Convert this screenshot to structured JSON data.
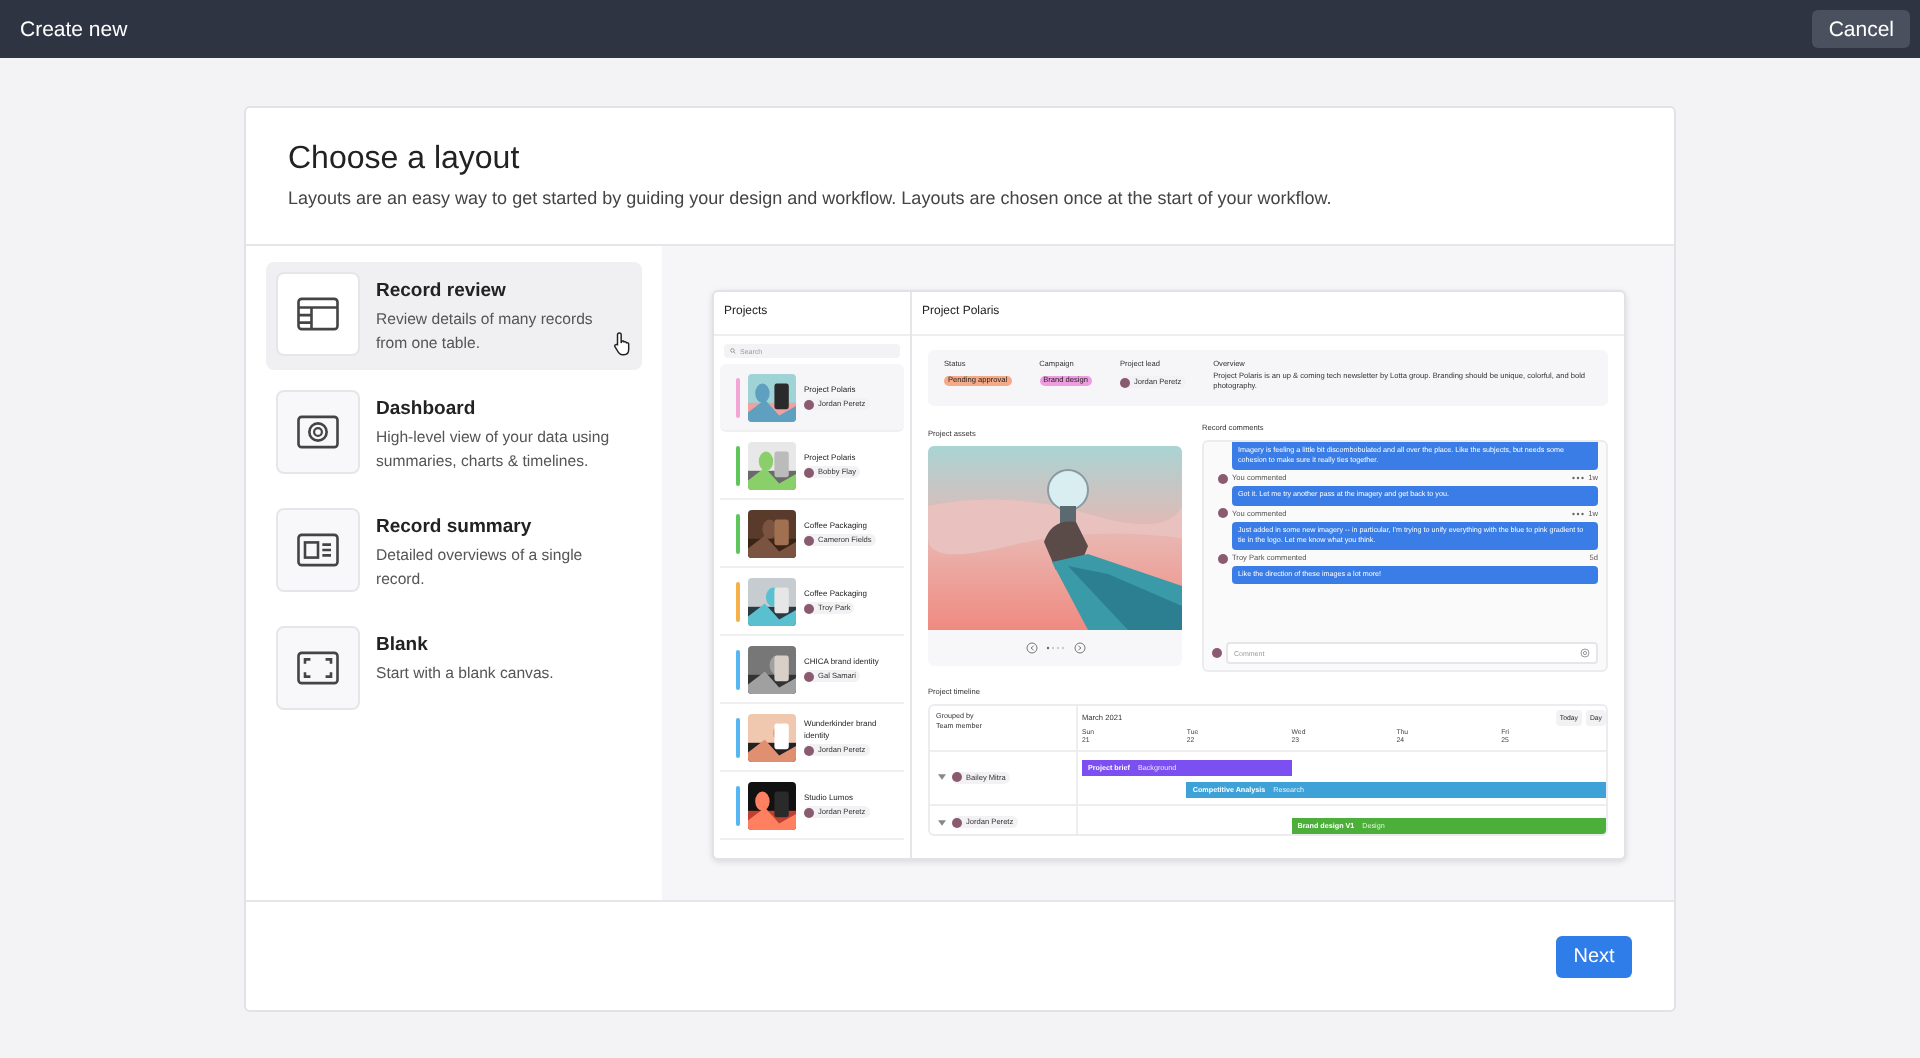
{
  "top_bar": {
    "title": "Create new",
    "cancel": "Cancel"
  },
  "dialog": {
    "title": "Choose a layout",
    "subtitle": "Layouts are an easy way to get started by guiding your design and workflow. Layouts are chosen once at the start of your workflow.",
    "next": "Next"
  },
  "layouts": [
    {
      "name": "Record review",
      "description": "Review details of many records from one table.",
      "selected": true
    },
    {
      "name": "Dashboard",
      "description": "High-level view of your data using summaries, charts & timelines.",
      "selected": false
    },
    {
      "name": "Record summary",
      "description": "Detailed overviews of a single record.",
      "selected": false
    },
    {
      "name": "Blank",
      "description": "Start with a blank canvas.",
      "selected": false
    }
  ],
  "preview": {
    "projects_title": "Projects",
    "search_placeholder": "Search",
    "projects": [
      {
        "name": "Project Polaris",
        "owner": "Jordan Peretz",
        "color": "#f3a6d6",
        "selected": true
      },
      {
        "name": "Project Polaris",
        "owner": "Bobby Flay",
        "color": "#5ec65b",
        "selected": false
      },
      {
        "name": "Coffee Packaging",
        "owner": "Cameron Fields",
        "color": "#5ec65b",
        "selected": false
      },
      {
        "name": "Coffee Packaging",
        "owner": "Troy Park",
        "color": "#f5b04a",
        "selected": false
      },
      {
        "name": "CHICA brand identity",
        "owner": "Gal Samari",
        "color": "#56b6f2",
        "selected": false
      },
      {
        "name": "Wunderkinder brand identity",
        "owner": "Jordan Peretz",
        "color": "#56b6f2",
        "selected": false
      },
      {
        "name": "Studio Lumos",
        "owner": "Jordan Peretz",
        "color": "#56b6f2",
        "selected": false
      }
    ],
    "record_title": "Project Polaris",
    "fields": [
      {
        "label": "Status",
        "value": "Pending approval",
        "color": "#f6a987"
      },
      {
        "label": "Campaign",
        "value": "Brand design",
        "color": "#ee9be0"
      }
    ],
    "lead": {
      "label": "Project lead",
      "value": "Jordan Peretz"
    },
    "overview": {
      "label": "Overview",
      "text": "Project Polaris is an up & coming tech newsletter by Lotta group. Branding should be unique, colorful, and bold photography."
    },
    "assets_title": "Project assets",
    "comments_title": "Record comments",
    "comments": [
      {
        "text": "Imagery is feeling a little bit discombobulated and all over the place. Like the subjects, but needs some cohesion to make sure it really ties together."
      },
      {
        "author": "You commented",
        "time": "1w",
        "menu": true,
        "text": "Got it. Let me try another pass at the imagery and get back to you."
      },
      {
        "author": "You commented",
        "time": "1w",
        "menu": true,
        "text": "Just added in some new imagery -- in particular, I'm trying to unify everything with the blue to pink gradient to tie in the logo. Let me know what you think."
      },
      {
        "author": "Troy Park commented",
        "time": "5d",
        "menu": false,
        "text": "Like the direction of these images a lot more!"
      }
    ],
    "comment_placeholder": "Comment",
    "timeline": {
      "title": "Project timeline",
      "group_label": "Grouped by",
      "group_value": "Team member",
      "month": "March 2021",
      "buttons": [
        "Today",
        "Day"
      ],
      "days": [
        {
          "day": "Sun",
          "date": "21"
        },
        {
          "day": "Tue",
          "date": "22"
        },
        {
          "day": "Wed",
          "date": "23"
        },
        {
          "day": "Thu",
          "date": "24"
        },
        {
          "day": "Fri",
          "date": "25"
        }
      ],
      "members": [
        "Bailey Mitra",
        "Jordan Peretz"
      ],
      "bars": [
        {
          "title": "Project brief",
          "tag": "Background",
          "color": "#7b4ff0"
        },
        {
          "title": "Competitive Analysis",
          "tag": "Research",
          "color": "#3ea2d8"
        },
        {
          "title": "Brand design V1",
          "tag": "Design",
          "color": "#4caf3a"
        }
      ]
    }
  }
}
